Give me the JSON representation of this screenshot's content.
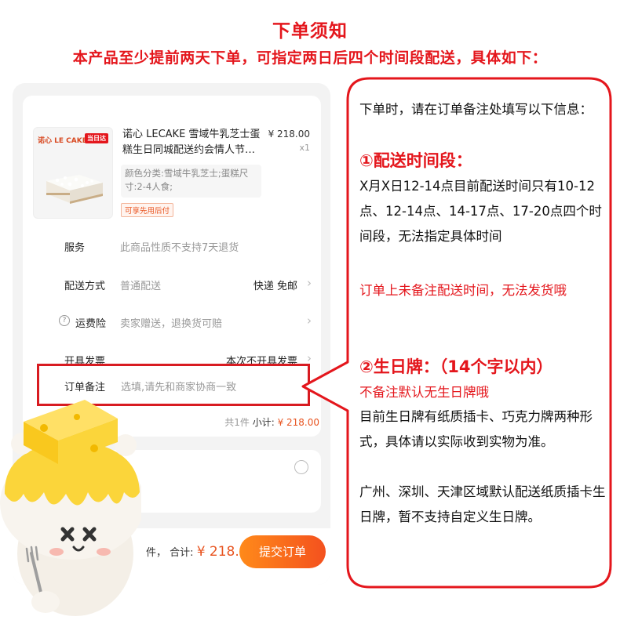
{
  "header": {
    "title": "下单须知",
    "subtitle": "本产品至少提前两天下单，可指定两日后四个时间段配送，具体如下："
  },
  "product": {
    "brand": "诺心 LE CAKE",
    "badge": "当日达",
    "title": "诺心 LECAKE 雪域牛乳芝士蛋糕生日同城配送约会情人节…",
    "price": "¥ 218.00",
    "qty": "x1",
    "spec": "颜色分类:雪域牛乳芝士;蛋糕尺寸:2-4人食;",
    "pay_tag": "可享先用后付"
  },
  "rows": {
    "service": {
      "label": "服务",
      "value": "此商品性质不支持7天退货"
    },
    "delivery": {
      "label": "配送方式",
      "value": "普通配送",
      "right": "快递 免邮"
    },
    "insurance": {
      "label": "运费险",
      "value": "卖家赠送，退换货可赔"
    },
    "invoice": {
      "label": "开具发票",
      "right": "本次不开具发票"
    },
    "remark": {
      "label": "订单备注",
      "placeholder": "选填,请先和商家协商一致"
    }
  },
  "subtotal": {
    "count": "共1件",
    "label": "小计:",
    "price": "¥ 218.00"
  },
  "bottom": {
    "partial": "件，",
    "total_label": "合计:",
    "total_price": "¥ 218.00",
    "submit": "提交订单"
  },
  "info": {
    "intro": "下单时，请在订单备注处填写以下信息：",
    "sec1_heading": "①配送时间段：",
    "sec1_body": "X月X日12-14点目前配送时间只有10-12点、12-14点、14-17点、17-20点四个时间段，无法指定具体时间",
    "sec1_warning": "订单上未备注配送时间，无法发货哦",
    "sec2_heading": "②生日牌：（14个字以内）",
    "sec2_warning": "不备注默认无生日牌哦",
    "sec2_body1": "目前生日牌有纸质插卡、巧克力牌两种形式，具体请以实际收到实物为准。",
    "sec2_body2": "广州、深圳、天津区域默认配送纸质插卡生日牌，暂不支持自定义生日牌。"
  },
  "colors": {
    "accent_red": "#e4161c",
    "price_orange": "#e85420",
    "button_gradient_start": "#ff8a1a",
    "button_gradient_end": "#f4511e"
  }
}
